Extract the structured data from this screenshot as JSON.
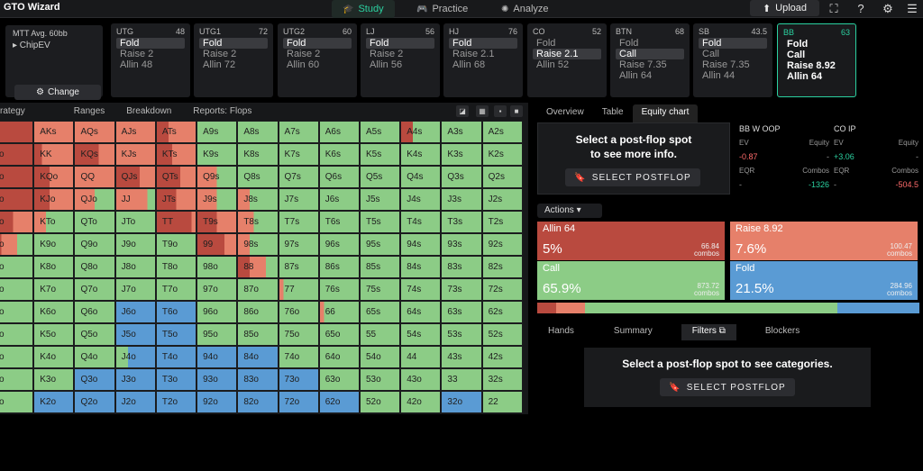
{
  "app": {
    "logo": "GTO Wizard"
  },
  "nav": [
    {
      "label": "Study",
      "icon": "🎓"
    },
    {
      "label": "Practice",
      "icon": "🎮"
    },
    {
      "label": "Analyze",
      "icon": "✺"
    }
  ],
  "toolbar": {
    "upload_label": "Upload"
  },
  "settings": {
    "line1": "MTT  Avg. 60bb",
    "line2": "▸ ChipEV",
    "change_label": "Change"
  },
  "positions": [
    {
      "name": "UTG",
      "stack": "48",
      "actions": [
        "Fold",
        "Raise 2",
        "Allin 48"
      ],
      "hl": 0
    },
    {
      "name": "UTG1",
      "stack": "72",
      "actions": [
        "Fold",
        "Raise 2",
        "Allin 72"
      ],
      "hl": 0
    },
    {
      "name": "UTG2",
      "stack": "60",
      "actions": [
        "Fold",
        "Raise 2",
        "Allin 60"
      ],
      "hl": 0
    },
    {
      "name": "LJ",
      "stack": "56",
      "actions": [
        "Fold",
        "Raise 2",
        "Allin 56"
      ],
      "hl": 0
    },
    {
      "name": "HJ",
      "stack": "76",
      "actions": [
        "Fold",
        "Raise 2.1",
        "Allin 68"
      ],
      "hl": 0
    },
    {
      "name": "CO",
      "stack": "52",
      "actions": [
        "Fold",
        "Raise 2.1",
        "Allin 52"
      ],
      "hl": 1
    },
    {
      "name": "BTN",
      "stack": "68",
      "actions": [
        "Fold",
        "Call",
        "Raise 7.35",
        "Allin 64"
      ],
      "hl": 1
    },
    {
      "name": "SB",
      "stack": "43.5",
      "actions": [
        "Fold",
        "Call",
        "Raise 7.35",
        "Allin 44"
      ],
      "hl": 0
    },
    {
      "name": "BB",
      "stack": "63",
      "actions": [
        "Fold",
        "Call",
        "Raise 8.92",
        "Allin 64"
      ],
      "hl": -1
    }
  ],
  "left_tabs": [
    "rategy",
    "Ranges",
    "Breakdown",
    "Reports: Flops"
  ],
  "grid": [
    [
      "",
      "AKs",
      "AQs",
      "AJs",
      "ATs",
      "A9s",
      "A8s",
      "A7s",
      "A6s",
      "A5s",
      "A4s",
      "A3s",
      "A2s"
    ],
    [
      "o",
      "KK",
      "KQs",
      "KJs",
      "KTs",
      "K9s",
      "K8s",
      "K7s",
      "K6s",
      "K5s",
      "K4s",
      "K3s",
      "K2s"
    ],
    [
      "o",
      "KQo",
      "QQ",
      "QJs",
      "QTs",
      "Q9s",
      "Q8s",
      "Q7s",
      "Q6s",
      "Q5s",
      "Q4s",
      "Q3s",
      "Q2s"
    ],
    [
      "o",
      "KJo",
      "QJo",
      "JJ",
      "JTs",
      "J9s",
      "J8s",
      "J7s",
      "J6s",
      "J5s",
      "J4s",
      "J3s",
      "J2s"
    ],
    [
      "o",
      "KTo",
      "QTo",
      "JTo",
      "TT",
      "T9s",
      "T8s",
      "T7s",
      "T6s",
      "T5s",
      "T4s",
      "T3s",
      "T2s"
    ],
    [
      "o",
      "K9o",
      "Q9o",
      "J9o",
      "T9o",
      "99",
      "98s",
      "97s",
      "96s",
      "95s",
      "94s",
      "93s",
      "92s"
    ],
    [
      "o",
      "K8o",
      "Q8o",
      "J8o",
      "T8o",
      "98o",
      "88",
      "87s",
      "86s",
      "85s",
      "84s",
      "83s",
      "82s"
    ],
    [
      "o",
      "K7o",
      "Q7o",
      "J7o",
      "T7o",
      "97o",
      "87o",
      "77",
      "76s",
      "75s",
      "74s",
      "73s",
      "72s"
    ],
    [
      "o",
      "K6o",
      "Q6o",
      "J6o",
      "T6o",
      "96o",
      "86o",
      "76o",
      "66",
      "65s",
      "64s",
      "63s",
      "62s"
    ],
    [
      "o",
      "K5o",
      "Q5o",
      "J5o",
      "T5o",
      "95o",
      "85o",
      "75o",
      "65o",
      "55",
      "54s",
      "53s",
      "52s"
    ],
    [
      "o",
      "K4o",
      "Q4o",
      "J4o",
      "T4o",
      "94o",
      "84o",
      "74o",
      "64o",
      "54o",
      "44",
      "43s",
      "42s"
    ],
    [
      "o",
      "K3o",
      "Q3o",
      "J3o",
      "T3o",
      "93o",
      "83o",
      "73o",
      "63o",
      "53o",
      "43o",
      "33",
      "32s"
    ],
    [
      "o",
      "K2o",
      "Q2o",
      "J2o",
      "T2o",
      "92o",
      "82o",
      "72o",
      "62o",
      "52o",
      "42o",
      "32o",
      "22"
    ]
  ],
  "right_tabs": [
    "Overview",
    "Table",
    "Equity chart"
  ],
  "equity_panel": {
    "msg1": "Select a post-flop spot",
    "msg2": "to see more info.",
    "button": "SELECT POSTFLOP"
  },
  "ev_panels": [
    {
      "title": "BB  W  OOP",
      "ev_label": "EV",
      "ev": "-0.87",
      "eq_label": "Equity",
      "eq": "-",
      "eqr_label": "EQR",
      "eqr": "-",
      "combos_label": "Combos",
      "combos": "-1326"
    },
    {
      "title": "CO  IP",
      "ev_label": "EV",
      "ev": "+3.06",
      "eq_label": "Equity",
      "eq": "-",
      "eqr_label": "EQR",
      "eqr": "-",
      "combos_label": "Combos",
      "combos": "-504.5"
    }
  ],
  "actions": {
    "label": "Actions",
    "tiles": [
      {
        "name": "Allin 64",
        "pct": "5%",
        "combos": "66.84",
        "unit": "combos",
        "color": "#b94a3f"
      },
      {
        "name": "Raise 8.92",
        "pct": "7.6%",
        "combos": "100.47",
        "unit": "combos",
        "color": "#e6806a"
      },
      {
        "name": "Call",
        "pct": "65.9%",
        "combos": "873.72",
        "unit": "combos",
        "color": "#8ccc86"
      },
      {
        "name": "Fold",
        "pct": "21.5%",
        "combos": "284.96",
        "unit": "combos",
        "color": "#5a9bd4"
      }
    ],
    "freq": [
      0.05,
      0.076,
      0.659,
      0.215
    ]
  },
  "bottom_tabs": [
    "Hands",
    "Summary",
    "Filters",
    "Blockers"
  ],
  "categories": {
    "msg": "Select a post-flop spot to see categories.",
    "button": "SELECT POSTFLOP"
  },
  "colors": {
    "allin": "#b94a3f",
    "raise": "#e6806a",
    "call": "#8ccc86",
    "fold": "#5a9bd4",
    "accent": "#2bd1a0"
  }
}
